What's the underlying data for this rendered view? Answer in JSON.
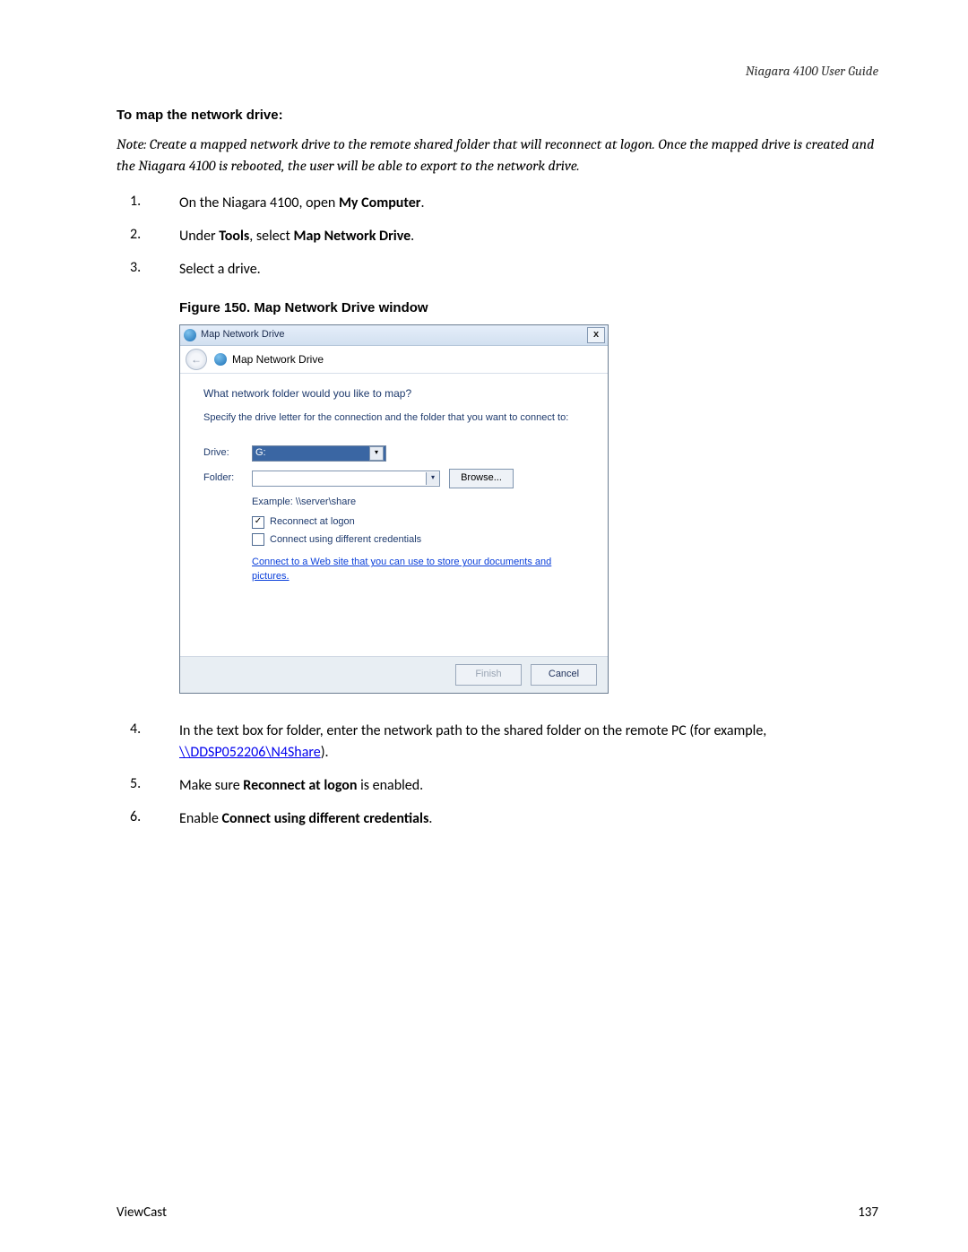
{
  "header": {
    "right": "Niagara 4100 User Guide"
  },
  "section_title": "To map the network drive:",
  "note": "Note: Create a mapped network drive to the remote shared folder that will reconnect at logon. Once the mapped drive is created and the Niagara 4100 is rebooted, the user will be able to export to the network drive.",
  "steps": {
    "s1": {
      "num": "1.",
      "pre": "On the Niagara 4100, open ",
      "bold": "My Computer",
      "post": "."
    },
    "s2": {
      "num": "2.",
      "pre": "Under ",
      "bold1": "Tools",
      "mid": ", select ",
      "bold2": "Map Network Drive",
      "post": "."
    },
    "s3": {
      "num": "3.",
      "text": "Select a drive."
    },
    "s4": {
      "num": "4.",
      "pre": "In the text box for folder, enter the network path to the shared folder on the remote PC (for example, ",
      "link": "\\\\DDSP052206\\N4Share",
      "post": ")."
    },
    "s5": {
      "num": "5.",
      "pre": "Make sure ",
      "bold": "Reconnect at logon",
      "post": " is enabled."
    },
    "s6": {
      "num": "6.",
      "pre": "Enable ",
      "bold": "Connect using different credentials",
      "post": "."
    }
  },
  "figure_caption": "Figure 150. Map Network Drive window",
  "dialog": {
    "title": "Map Network Drive",
    "close": "x",
    "nav_title": "Map Network Drive",
    "heading": "What network folder would you like to map?",
    "sub": "Specify the drive letter for the connection and the folder that you want to connect to:",
    "drive_label": "Drive:",
    "drive_value": "G:",
    "folder_label": "Folder:",
    "browse": "Browse...",
    "example": "Example: \\\\server\\share",
    "reconnect_check": "✓",
    "reconnect_label": "Reconnect at logon",
    "diffcred_label": "Connect using different credentials",
    "link": "Connect to a Web site that you can use to store your documents and pictures.",
    "finish": "Finish",
    "cancel": "Cancel"
  },
  "footer": {
    "left": "ViewCast",
    "right": "137"
  }
}
